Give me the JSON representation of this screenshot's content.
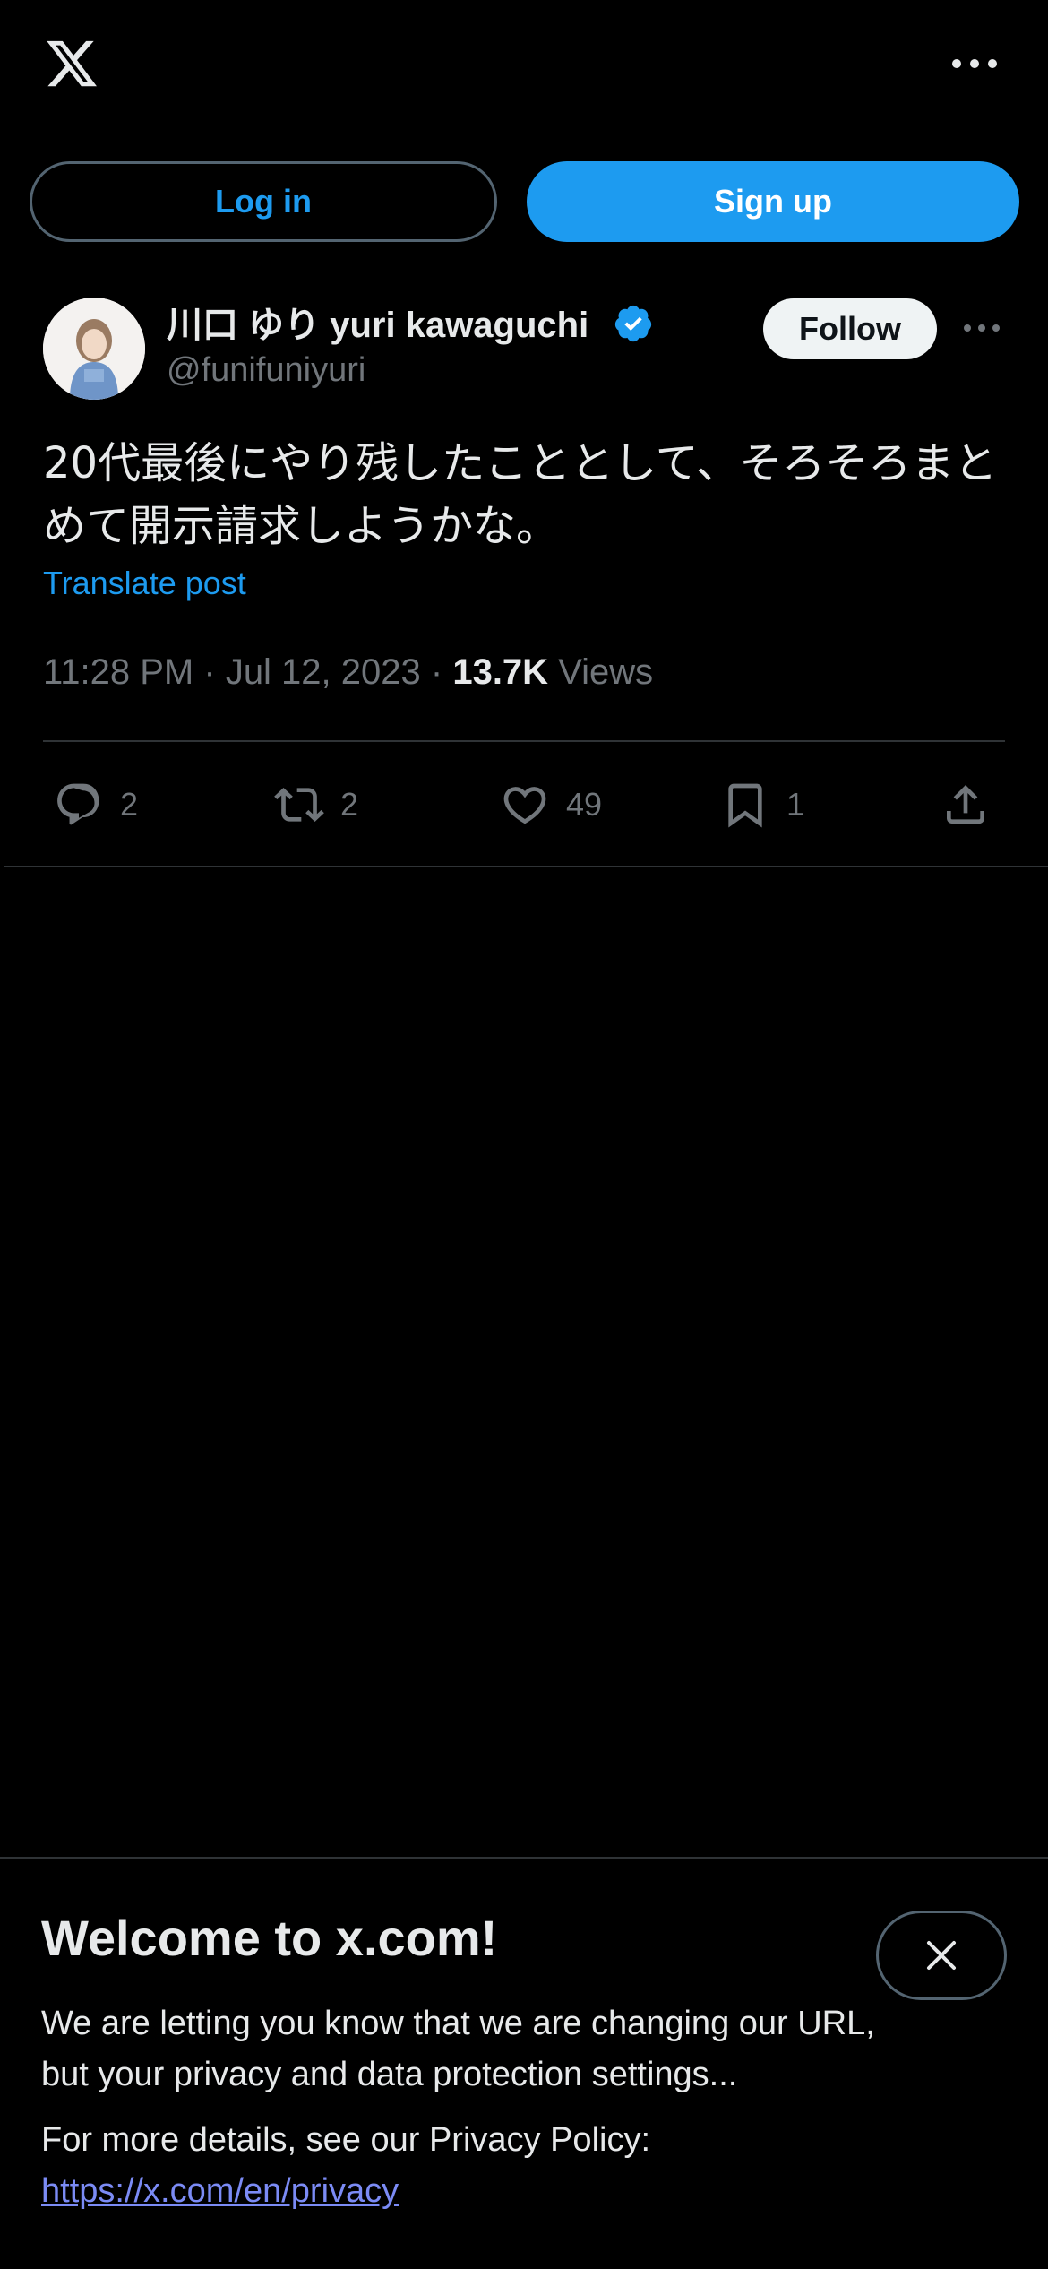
{
  "header": {
    "logo_icon": "x-logo-icon",
    "more_icon": "more-horizontal-icon"
  },
  "auth": {
    "login_label": "Log in",
    "signup_label": "Sign up"
  },
  "post": {
    "display_name": "川口 ゆり yuri kawaguchi",
    "handle": "@funifuniyuri",
    "follow_label": "Follow",
    "text": "20代最後にやり残したこととして、そろそろまとめて開示請求しようかな。",
    "translate_label": "Translate post",
    "time": "11:28 PM",
    "date": "Jul 12, 2023",
    "views_count": "13.7K",
    "views_label": "Views",
    "actions": {
      "replies": "2",
      "reposts": "2",
      "likes": "49",
      "bookmarks": "1"
    }
  },
  "banner": {
    "title": "Welcome to x.com!",
    "body": "We are letting you know that we are changing our URL, but your privacy and data protection settings...",
    "more": "For more details, see our Privacy Policy:",
    "link": "https://x.com/en/privacy"
  },
  "colors": {
    "accent": "#1d9bf0",
    "background": "#000000",
    "text": "#e7e9ea",
    "muted": "#71767b",
    "border": "#2f3336"
  }
}
